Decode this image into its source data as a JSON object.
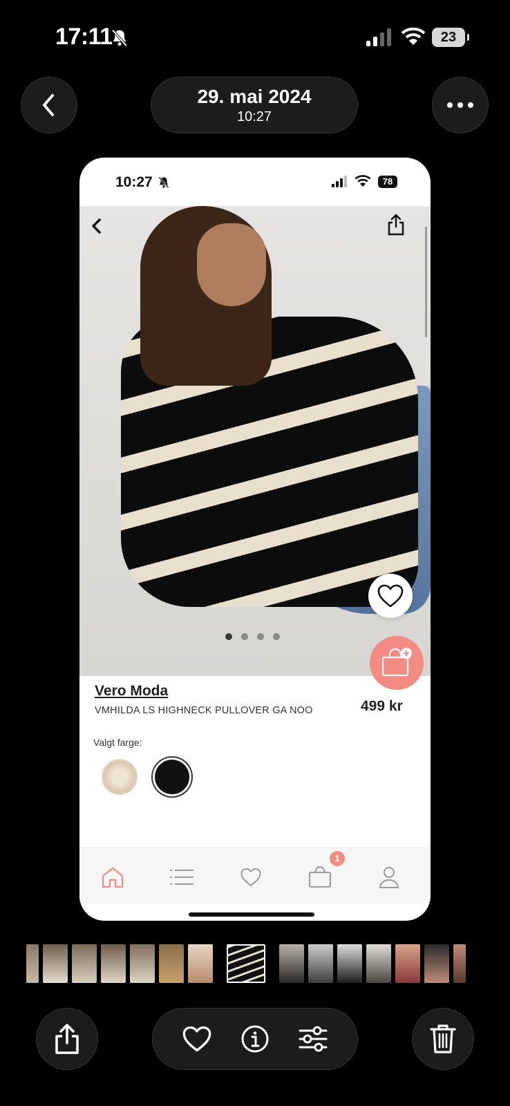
{
  "status_bar": {
    "time": "17:11",
    "battery": "23"
  },
  "header": {
    "date": "29. mai 2024",
    "time": "10:27"
  },
  "screenshot": {
    "status_bar": {
      "time": "10:27",
      "battery": "78"
    },
    "product": {
      "brand": "Vero Moda",
      "name": "VMHILDA LS HIGHNECK PULLOVER GA NOO",
      "price": "499 kr",
      "color_label": "Valgt farge:",
      "colors": [
        "cream",
        "black"
      ],
      "selected_color": "black",
      "image_count": 4,
      "active_image": 1
    },
    "tabbar": {
      "items": [
        "home",
        "list",
        "favorites",
        "cart",
        "profile"
      ],
      "active": "home",
      "cart_badge": "1"
    },
    "accent_color": "#f28b82"
  },
  "toolbar": {
    "buttons": [
      "share",
      "favorite",
      "info",
      "adjust",
      "delete"
    ]
  }
}
